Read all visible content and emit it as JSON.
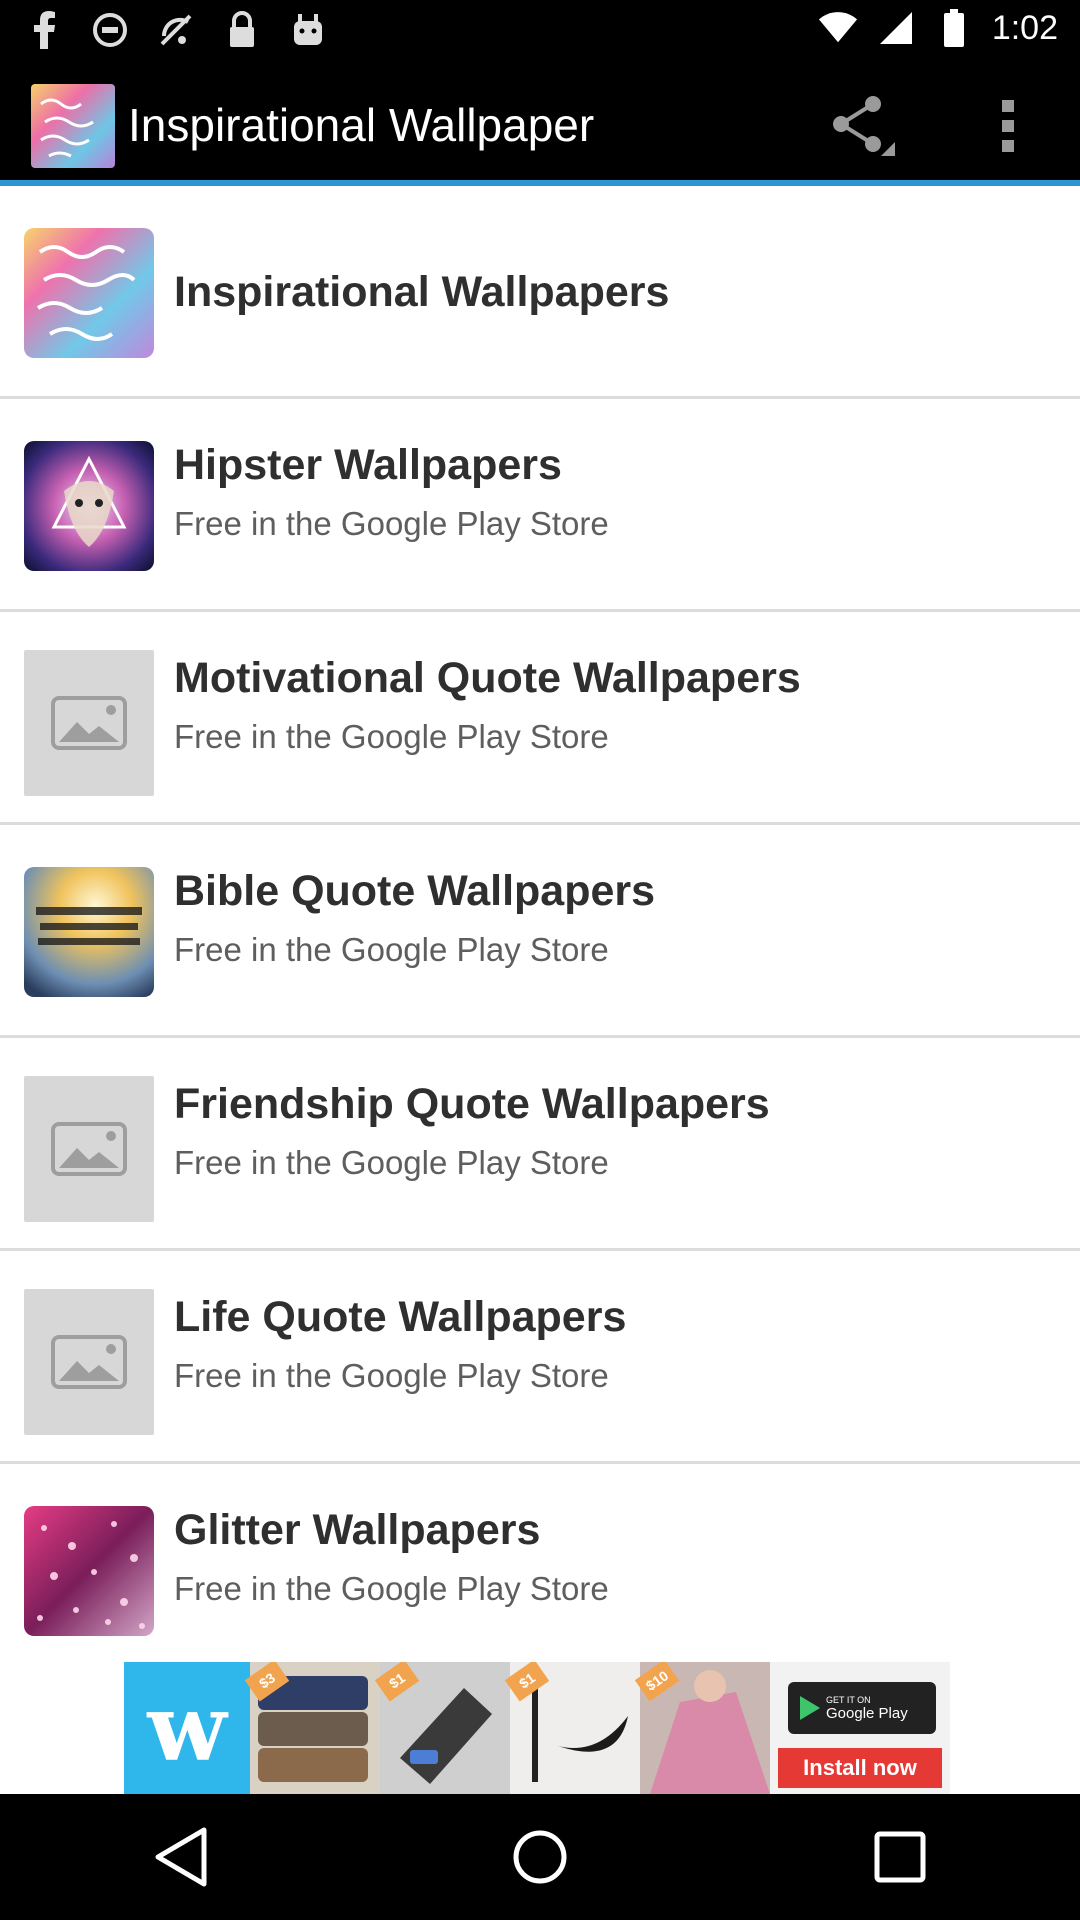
{
  "status_bar": {
    "time": "1:02",
    "left_icons": [
      "facebook-icon",
      "blocked-icon",
      "no-signal-icon",
      "lock-icon",
      "android-icon"
    ]
  },
  "action_bar": {
    "title": "Inspirational Wallpaper",
    "accent_color": "#2b95d6"
  },
  "list": {
    "items": [
      {
        "title": "Inspirational Wallpapers",
        "subtitle": "",
        "thumb": "inspirational-thumb"
      },
      {
        "title": "Hipster Wallpapers",
        "subtitle": "Free in the Google Play Store",
        "thumb": "hipster-thumb"
      },
      {
        "title": "Motivational Quote Wallpapers",
        "subtitle": "Free in the Google Play Store",
        "thumb": "placeholder-image-icon"
      },
      {
        "title": "Bible Quote Wallpapers",
        "subtitle": "Free in the Google Play Store",
        "thumb": "bible-thumb"
      },
      {
        "title": "Friendship Quote Wallpapers",
        "subtitle": "Free in the Google Play Store",
        "thumb": "placeholder-image-icon"
      },
      {
        "title": "Life Quote Wallpapers",
        "subtitle": "Free in the Google Play Store",
        "thumb": "placeholder-image-icon"
      },
      {
        "title": "Glitter Wallpapers",
        "subtitle": "Free in the Google Play Store",
        "thumb": "glitter-thumb"
      }
    ]
  },
  "ad": {
    "brand_letter": "w",
    "prices": [
      "$3",
      "$1",
      "$1",
      "$10"
    ],
    "badge_small": "GET IT ON",
    "badge_large": "Google Play",
    "cta": "Install now"
  },
  "nav_bar": {
    "buttons": [
      "back-icon",
      "home-icon",
      "recents-icon"
    ]
  }
}
